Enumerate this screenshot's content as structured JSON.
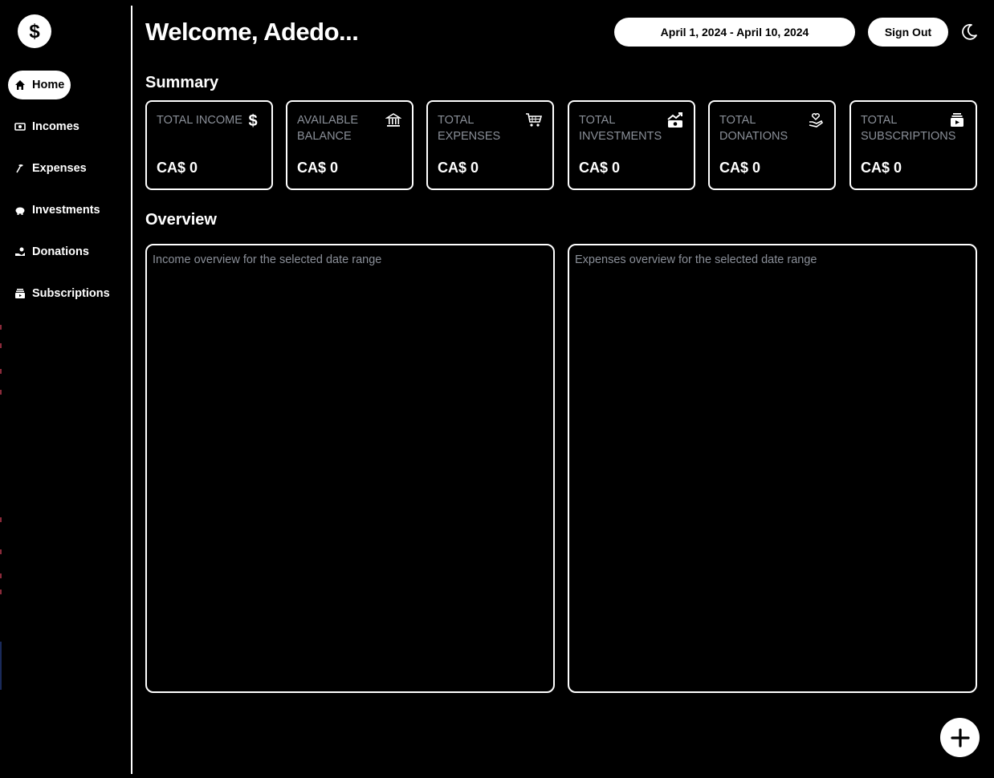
{
  "app": {
    "logo_icon": "dollar-icon"
  },
  "sidebar": {
    "items": [
      {
        "label": "Home",
        "icon": "home-icon",
        "active": true
      },
      {
        "label": "Incomes",
        "icon": "money-icon",
        "active": false
      },
      {
        "label": "Expenses",
        "icon": "expenses-icon",
        "active": false
      },
      {
        "label": "Investments",
        "icon": "piggy-bank-icon",
        "active": false
      },
      {
        "label": "Donations",
        "icon": "donation-icon",
        "active": false
      },
      {
        "label": "Subscriptions",
        "icon": "subscription-icon",
        "active": false
      }
    ]
  },
  "header": {
    "title": "Welcome, Adedo...",
    "date_range": "April 1, 2024 - April 10, 2024",
    "sign_out": "Sign Out",
    "theme_icon": "moon-icon"
  },
  "summary": {
    "title": "Summary",
    "cards": [
      {
        "label": "Total Income",
        "value": "CA$ 0",
        "icon": "dollar-icon"
      },
      {
        "label": "Available Balance",
        "value": "CA$ 0",
        "icon": "bank-icon"
      },
      {
        "label": "Total Expenses",
        "value": "CA$ 0",
        "icon": "cart-icon"
      },
      {
        "label": "Total Investments",
        "value": "CA$ 0",
        "icon": "investment-icon"
      },
      {
        "label": "Total Donations",
        "value": "CA$ 0",
        "icon": "donation-icon"
      },
      {
        "label": "Total Subscriptions",
        "value": "CA$ 0",
        "icon": "subscription-icon"
      }
    ]
  },
  "overview": {
    "title": "Overview",
    "income_caption": "Income overview for the selected date range",
    "expenses_caption": "Expenses overview for the selected date range"
  },
  "fab": {
    "icon": "plus-icon"
  },
  "colors": {
    "background": "#000000",
    "foreground": "#ffffff",
    "muted_text": "#8a8f98"
  }
}
